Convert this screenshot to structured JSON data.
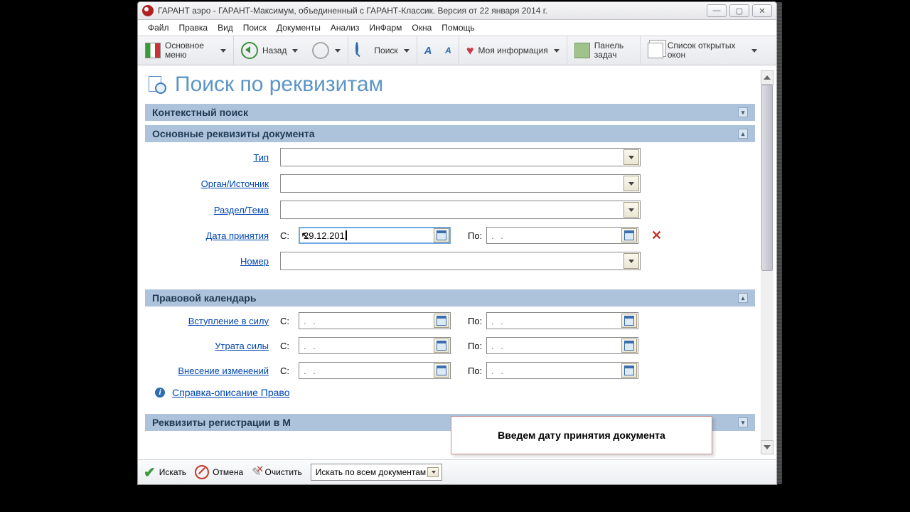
{
  "window": {
    "title": "ГАРАНТ аэро - ГАРАНТ-Максимум, объединенный с ГАРАНТ-Классик. Версия от 22 января 2014 г."
  },
  "menu": {
    "file": "Файл",
    "edit": "Правка",
    "view": "Вид",
    "search": "Поиск",
    "documents": "Документы",
    "analysis": "Анализ",
    "infarm": "ИнФарм",
    "windows": "Окна",
    "help": "Помощь"
  },
  "toolbar": {
    "main_menu": "Основное меню",
    "back": "Назад",
    "search": "Поиск",
    "my_info": "Моя информация",
    "task_panel": "Панель задач",
    "open_windows": "Список открытых окон"
  },
  "page": {
    "title": "Поиск по реквизитам"
  },
  "sections": {
    "context": "Контекстный поиск",
    "main": "Основные реквизиты документа",
    "calendar": "Правовой календарь",
    "registration": "Реквизиты регистрации в М"
  },
  "labels": {
    "type": "Тип",
    "organ": "Орган/Источник",
    "section": "Раздел/Тема",
    "date_adopt": "Дата принятия",
    "number": "Номер",
    "effective": "Вступление в силу",
    "expire": "Утрата силы",
    "amend": "Внесение изменений",
    "from": "С:",
    "to": "По:"
  },
  "values": {
    "date_adopt_from": "29.12.201",
    "date_adopt_to": ".  .",
    "effective_from": ".  .",
    "effective_to": ".  .",
    "expire_from": ".  .",
    "expire_to": ".  .",
    "amend_from": ".  .",
    "amend_to": ".  ."
  },
  "info_link": "Справка-описание Право",
  "tooltip": "Введем дату принятия документа",
  "footer": {
    "search": "Искать",
    "cancel": "Отмена",
    "clear": "Очистить",
    "scope": "Искать по всем документам"
  }
}
